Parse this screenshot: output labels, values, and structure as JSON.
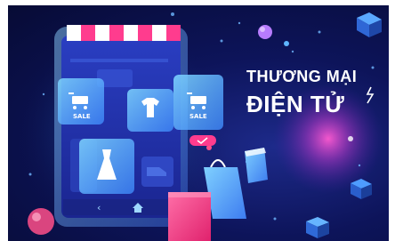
{
  "banner": {
    "title_line1": "THƯƠNG MẠI",
    "title_line2": "ĐIỆN TỬ"
  },
  "cards": {
    "sale_left": "SALE",
    "sale_right": "SALE"
  },
  "icons": [
    "shopping-cart-icon",
    "tshirt-icon",
    "dress-icon",
    "shoe-icon",
    "home-icon",
    "back-icon",
    "checkmark-icon",
    "shopping-bag-icon",
    "awning-icon"
  ],
  "colors": {
    "background": "#0b1150",
    "accent_pink": "#ff3c8e",
    "accent_cyan": "#3fc6ff",
    "panel_blue": "#4aa6ff"
  }
}
